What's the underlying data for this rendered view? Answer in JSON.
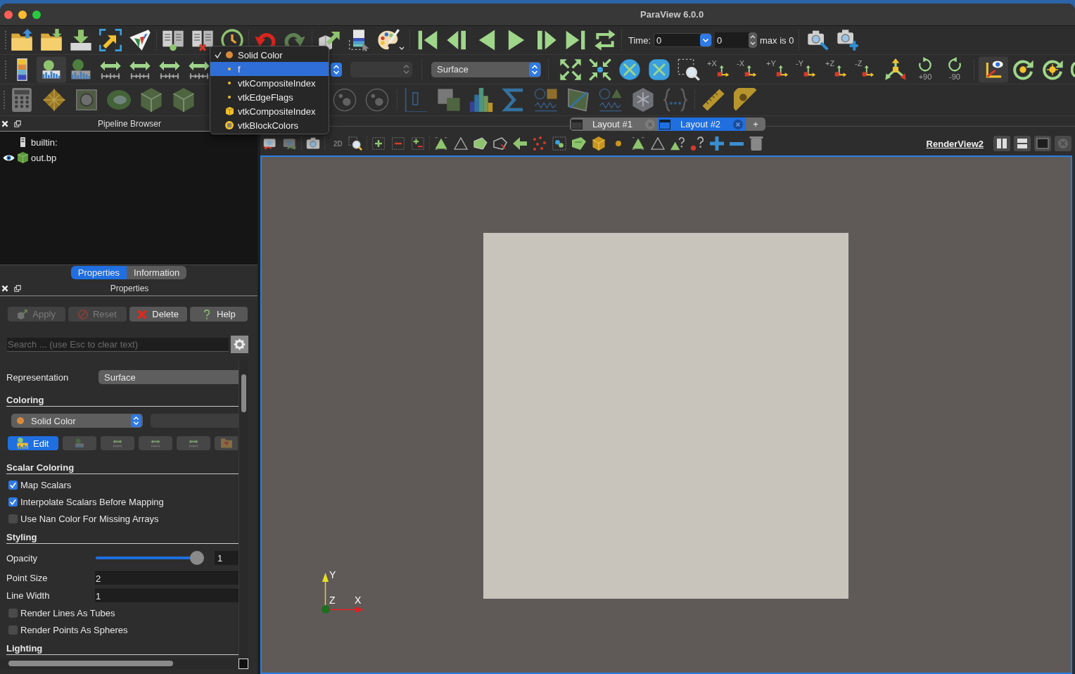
{
  "window": {
    "title": "ParaView 6.0.0"
  },
  "main_toolbar": {
    "time_label": "Time:",
    "time_value": "0",
    "timestep": "0",
    "max_label": "max is 0"
  },
  "view_toolbar": {
    "representation": "Surface",
    "camera_labels": [
      "+X",
      "-X",
      "+Y",
      "-Y",
      "+Z",
      "-Z"
    ],
    "rotate_labels": [
      "+90",
      "-90"
    ]
  },
  "coloring_menu": {
    "items": [
      {
        "label": "Solid Color",
        "kind": "solid",
        "checked": true,
        "selected": false
      },
      {
        "label": "f",
        "kind": "point",
        "checked": false,
        "selected": true
      },
      {
        "label": "vtkCompositeIndex",
        "kind": "point",
        "checked": false,
        "selected": false
      },
      {
        "label": "vtkEdgeFlags",
        "kind": "point",
        "checked": false,
        "selected": false
      },
      {
        "label": "vtkCompositeIndex",
        "kind": "cell",
        "checked": false,
        "selected": false
      },
      {
        "label": "vtkBlockColors",
        "kind": "field",
        "checked": false,
        "selected": false
      }
    ]
  },
  "pipeline_browser": {
    "title": "Pipeline Browser",
    "items": [
      {
        "label": "builtin:",
        "kind": "server",
        "selected": false,
        "children": [
          {
            "label": "out.bp",
            "kind": "source",
            "visible": true,
            "selected": false
          }
        ]
      }
    ]
  },
  "panel_tabs": [
    {
      "label": "Properties",
      "selected": true
    },
    {
      "label": "Information",
      "selected": false
    }
  ],
  "properties": {
    "title": "Properties",
    "buttons": [
      {
        "label": "Apply",
        "kind": "apply",
        "disabled": true
      },
      {
        "label": "Reset",
        "kind": "reset",
        "disabled": true
      },
      {
        "label": "Delete",
        "kind": "delete",
        "disabled": false
      },
      {
        "label": "Help",
        "kind": "help",
        "disabled": false
      }
    ],
    "search": {
      "placeholder": "Search ... (use Esc to clear text)"
    },
    "rows": [
      {
        "kind": "combo",
        "label": "Representation",
        "value": "Surface"
      },
      {
        "kind": "header",
        "label": "Coloring"
      },
      {
        "kind": "color_select",
        "selection": {
          "label": "Solid Color",
          "kind": "solid"
        }
      },
      {
        "kind": "button_row",
        "label": "Edit"
      },
      {
        "kind": "header",
        "label": "Scalar Coloring"
      },
      {
        "kind": "checkbox",
        "label": "Map Scalars",
        "checked": true
      },
      {
        "kind": "checkbox",
        "label": "Interpolate Scalars Before Mapping",
        "checked": true
      },
      {
        "kind": "checkbox",
        "label": "Use Nan Color For Missing Arrays",
        "checked": false
      },
      {
        "kind": "header",
        "label": "Styling"
      },
      {
        "kind": "slider",
        "label": "Opacity",
        "level": 1,
        "value": "1"
      },
      {
        "kind": "number",
        "label": "Point Size",
        "value": "2"
      },
      {
        "kind": "number",
        "label": "Line Width",
        "value": "1"
      },
      {
        "kind": "checkbox",
        "label": "Render Lines As Tubes",
        "checked": false
      },
      {
        "kind": "checkbox",
        "label": "Render Points As Spheres",
        "checked": false
      },
      {
        "kind": "header",
        "label": "Lighting"
      }
    ]
  },
  "layout_tabs": {
    "tabs": [
      {
        "label": "Layout #1",
        "selected": false
      },
      {
        "label": "Layout #2",
        "selected": true
      }
    ],
    "add_label": "+"
  },
  "render_toolbar": {
    "mode_label": "2D",
    "view_name": "RenderView2"
  },
  "render_view": {
    "axes": {
      "x": "X",
      "y": "Y",
      "z": "Z"
    }
  }
}
